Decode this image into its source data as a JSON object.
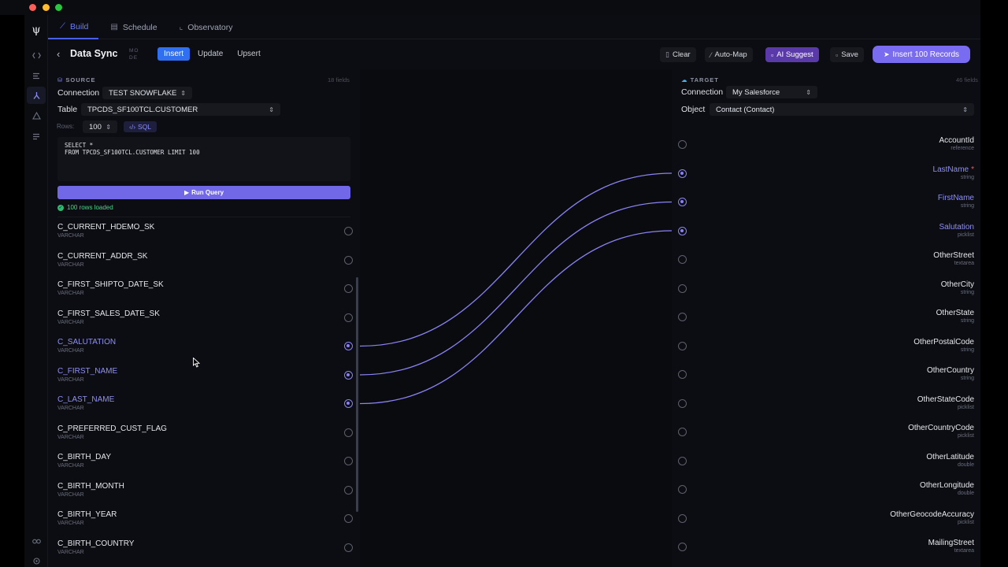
{
  "window": {
    "controls": [
      "close",
      "minimize",
      "zoom"
    ]
  },
  "rail": {
    "icons": [
      "app-logo-icon",
      "code-icon",
      "list-icon",
      "flow-icon",
      "alert-icon",
      "menu-icon",
      "binoculars-icon",
      "settings-icon"
    ],
    "logo_glyph": "ψ"
  },
  "tabs": [
    {
      "label": "Build",
      "icon": "wand-icon",
      "active": true
    },
    {
      "label": "Schedule",
      "icon": "calendar-icon",
      "active": false
    },
    {
      "label": "Observatory",
      "icon": "chart-icon",
      "active": false
    }
  ],
  "header": {
    "title": "Data Sync",
    "mode_label": "MO DE",
    "modes": [
      "Insert",
      "Update",
      "Upsert"
    ],
    "active_mode": "Insert",
    "actions": {
      "clear": "Clear",
      "auto_map": "Auto-Map",
      "ai_suggest": "AI Suggest",
      "save": "Save",
      "insert": "Insert 100 Records"
    }
  },
  "source": {
    "heading": "SOURCE",
    "field_count": "18 fields",
    "connection_label": "Connection",
    "connection_value": "TEST SNOWFLAKE",
    "table_label": "Table",
    "table_value": "TPCDS_SF100TCL.CUSTOMER",
    "rows_label": "Rows:",
    "rows_value": "100",
    "sql_label": "SQL",
    "sql_text": "SELECT *\nFROM TPCDS_SF100TCL.CUSTOMER LIMIT 100",
    "run_label": "Run Query",
    "status": "100 rows loaded",
    "fields": [
      {
        "name": "C_CURRENT_HDEMO_SK",
        "type": "VARCHAR",
        "mapped": false
      },
      {
        "name": "C_CURRENT_ADDR_SK",
        "type": "VARCHAR",
        "mapped": false
      },
      {
        "name": "C_FIRST_SHIPTO_DATE_SK",
        "type": "VARCHAR",
        "mapped": false
      },
      {
        "name": "C_FIRST_SALES_DATE_SK",
        "type": "VARCHAR",
        "mapped": false
      },
      {
        "name": "C_SALUTATION",
        "type": "VARCHAR",
        "mapped": true
      },
      {
        "name": "C_FIRST_NAME",
        "type": "VARCHAR",
        "mapped": true
      },
      {
        "name": "C_LAST_NAME",
        "type": "VARCHAR",
        "mapped": true
      },
      {
        "name": "C_PREFERRED_CUST_FLAG",
        "type": "VARCHAR",
        "mapped": false
      },
      {
        "name": "C_BIRTH_DAY",
        "type": "VARCHAR",
        "mapped": false
      },
      {
        "name": "C_BIRTH_MONTH",
        "type": "VARCHAR",
        "mapped": false
      },
      {
        "name": "C_BIRTH_YEAR",
        "type": "VARCHAR",
        "mapped": false
      },
      {
        "name": "C_BIRTH_COUNTRY",
        "type": "VARCHAR",
        "mapped": false
      }
    ]
  },
  "target": {
    "heading": "TARGET",
    "field_count": "46 fields",
    "connection_label": "Connection",
    "connection_value": "My Salesforce",
    "object_label": "Object",
    "object_value": "Contact (Contact)",
    "fields": [
      {
        "name": "AccountId",
        "type": "reference",
        "mapped": false,
        "required": false
      },
      {
        "name": "LastName",
        "type": "string",
        "mapped": true,
        "required": true
      },
      {
        "name": "FirstName",
        "type": "string",
        "mapped": true,
        "required": false
      },
      {
        "name": "Salutation",
        "type": "picklist",
        "mapped": true,
        "required": false
      },
      {
        "name": "OtherStreet",
        "type": "textarea",
        "mapped": false,
        "required": false
      },
      {
        "name": "OtherCity",
        "type": "string",
        "mapped": false,
        "required": false
      },
      {
        "name": "OtherState",
        "type": "string",
        "mapped": false,
        "required": false
      },
      {
        "name": "OtherPostalCode",
        "type": "string",
        "mapped": false,
        "required": false
      },
      {
        "name": "OtherCountry",
        "type": "string",
        "mapped": false,
        "required": false
      },
      {
        "name": "OtherStateCode",
        "type": "picklist",
        "mapped": false,
        "required": false
      },
      {
        "name": "OtherCountryCode",
        "type": "picklist",
        "mapped": false,
        "required": false
      },
      {
        "name": "OtherLatitude",
        "type": "double",
        "mapped": false,
        "required": false
      },
      {
        "name": "OtherLongitude",
        "type": "double",
        "mapped": false,
        "required": false
      },
      {
        "name": "OtherGeocodeAccuracy",
        "type": "picklist",
        "mapped": false,
        "required": false
      },
      {
        "name": "MailingStreet",
        "type": "textarea",
        "mapped": false,
        "required": false
      }
    ]
  },
  "mappings": [
    {
      "source": "C_SALUTATION",
      "target": "LastName"
    },
    {
      "source": "C_FIRST_NAME",
      "target": "FirstName"
    },
    {
      "source": "C_LAST_NAME",
      "target": "Salutation"
    }
  ],
  "colors": {
    "accent": "#7a6cf0",
    "link": "#8a82f5",
    "primary_blue": "#2f6ff0"
  }
}
